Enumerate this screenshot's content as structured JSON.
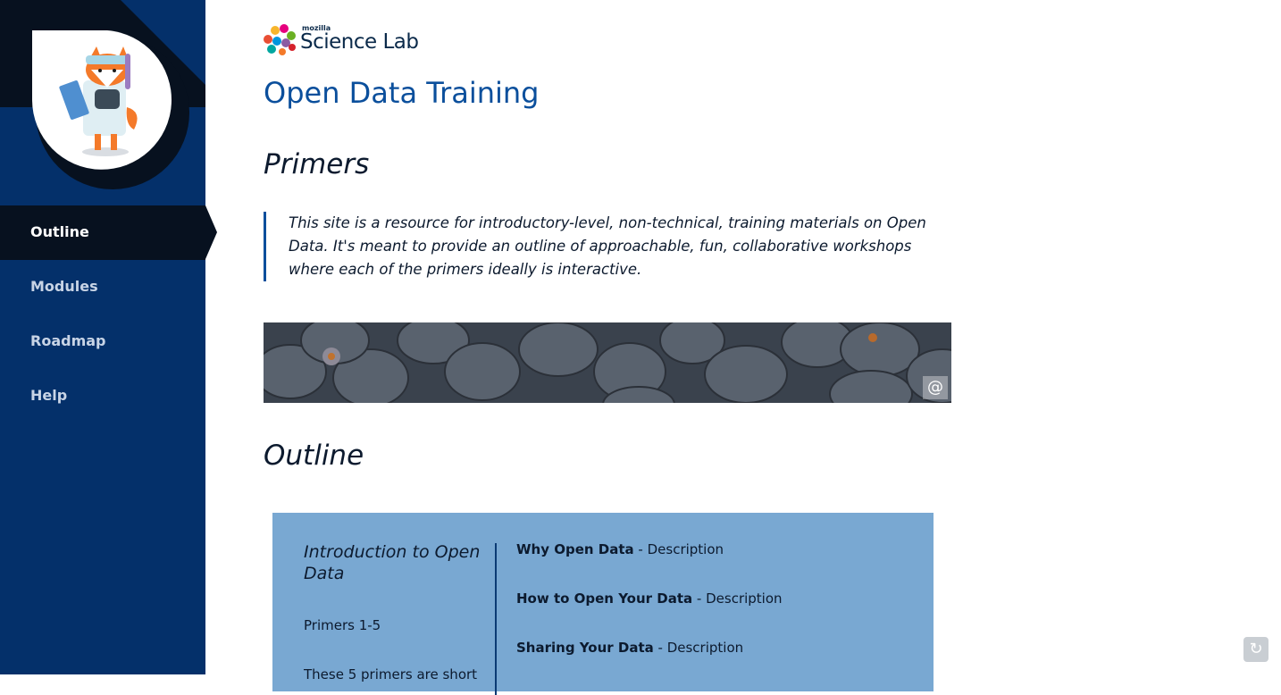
{
  "sidebar": {
    "mascot": "fox-scientist-icon",
    "nav": [
      {
        "label": "Outline",
        "active": true
      },
      {
        "label": "Modules",
        "active": false
      },
      {
        "label": "Roadmap",
        "active": false
      },
      {
        "label": "Help",
        "active": false
      }
    ]
  },
  "logo": {
    "small": "mozilla",
    "main": "Science Lab"
  },
  "page": {
    "title": "Open Data Training",
    "primers_heading": "Primers",
    "intro": "This site is a resource for introductory-level, non-technical, training materials on Open Data. It's meant to provide an outline of approachable, fun, collaborative workshops where each of the primers ideally is interactive.",
    "banner_icon": "at-sign-icon",
    "outline_heading": "Outline"
  },
  "outline_card": {
    "title": "Introduction to Open Data",
    "subtitle": "Primers 1-5",
    "more": "These 5 primers are short",
    "modules": [
      {
        "name": "Why Open Data",
        "desc": " - Description"
      },
      {
        "name": "How to Open Your Data",
        "desc": " - Description"
      },
      {
        "name": "Sharing Your Data",
        "desc": " - Description"
      }
    ]
  },
  "colors": {
    "sidebar": "#04306a",
    "title": "#0b4f9c",
    "card": "#79a8d2"
  }
}
